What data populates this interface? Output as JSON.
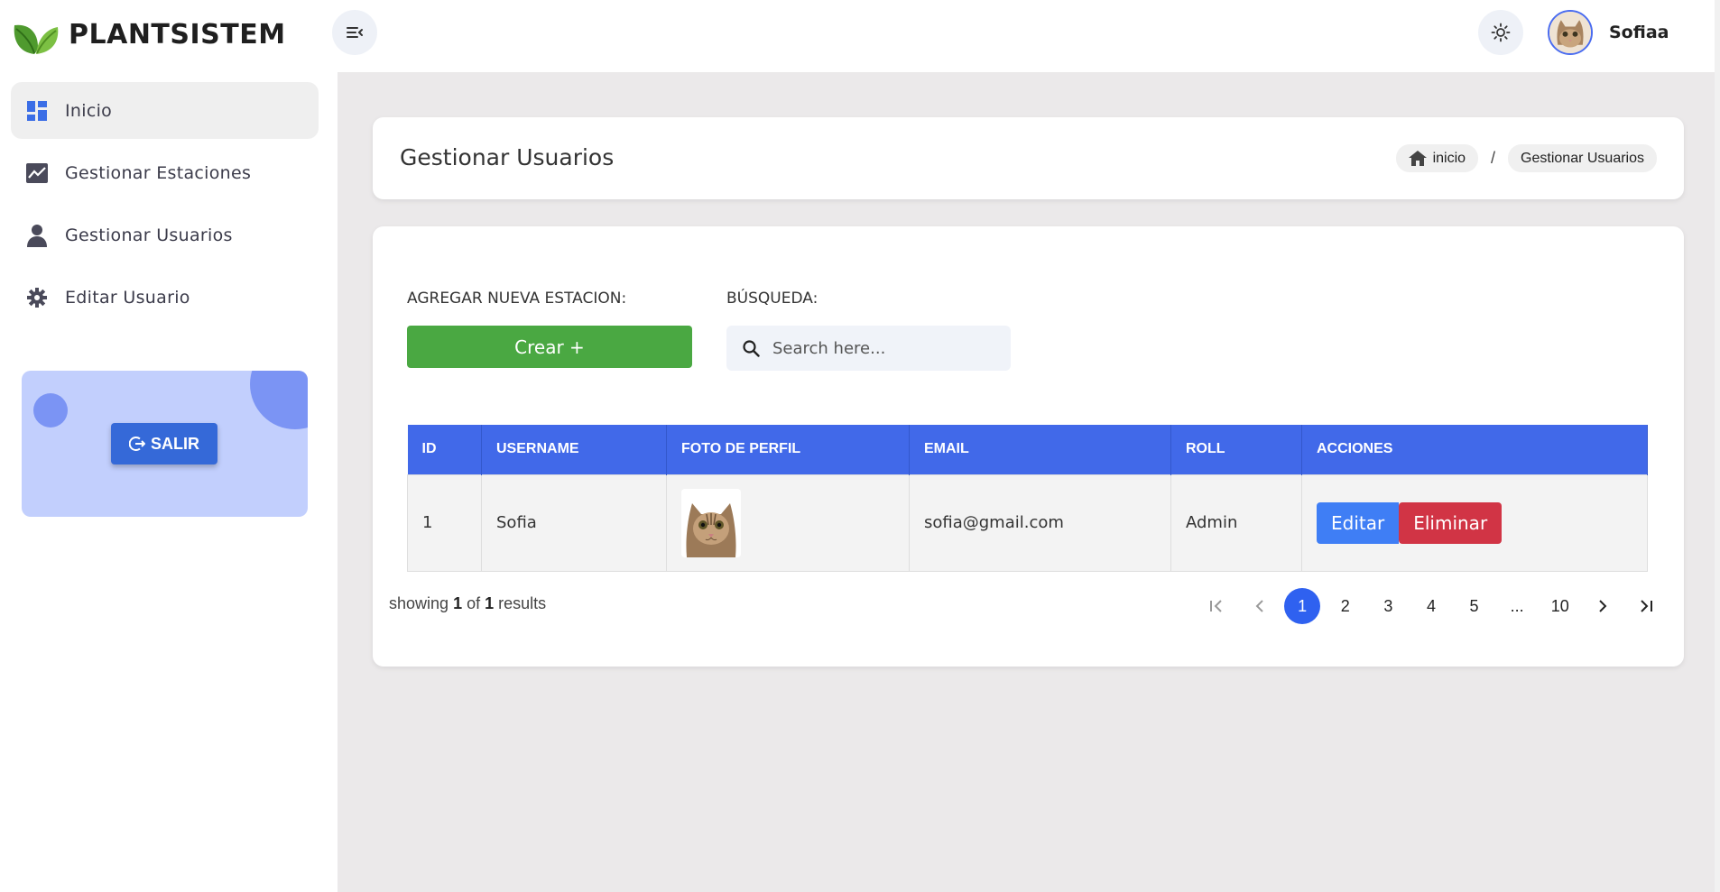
{
  "brand": {
    "name": "PLANTSISTEM"
  },
  "header": {
    "user_name": "Sofiaa"
  },
  "sidebar": {
    "items": [
      {
        "label": "Inicio",
        "icon": "dashboard-icon",
        "active": true
      },
      {
        "label": "Gestionar Estaciones",
        "icon": "chart-icon",
        "active": false
      },
      {
        "label": "Gestionar Usuarios",
        "icon": "user-icon",
        "active": false
      },
      {
        "label": "Editar Usuario",
        "icon": "gear-icon",
        "active": false
      }
    ],
    "logout_label": "SALIR"
  },
  "page": {
    "title": "Gestionar Usuarios",
    "breadcrumb": {
      "home": "inicio",
      "separator": "/",
      "current": "Gestionar Usuarios"
    }
  },
  "toolbar": {
    "create_label": "AGREGAR NUEVA ESTACION:",
    "create_button": "Crear +",
    "search_label": "BÚSQUEDA:",
    "search_placeholder": "Search here..."
  },
  "table": {
    "columns": [
      "ID",
      "USERNAME",
      "FOTO DE PERFIL",
      "EMAIL",
      "ROLL",
      "ACCIONES"
    ],
    "rows": [
      {
        "id": "1",
        "username": "Sofia",
        "email": "sofia@gmail.com",
        "roll": "Admin",
        "edit": "Editar",
        "delete": "Eliminar"
      }
    ]
  },
  "footer": {
    "showing_prefix": "showing",
    "showing_from": "1",
    "showing_of": "of",
    "showing_total": "1",
    "showing_suffix": "results"
  },
  "pagination": {
    "pages": [
      "1",
      "2",
      "3",
      "4",
      "5",
      "...",
      "10"
    ],
    "current": "1"
  },
  "colors": {
    "primary": "#4169e9",
    "success": "#4aa842",
    "danger": "#d13445",
    "edit": "#3f7ef5"
  }
}
